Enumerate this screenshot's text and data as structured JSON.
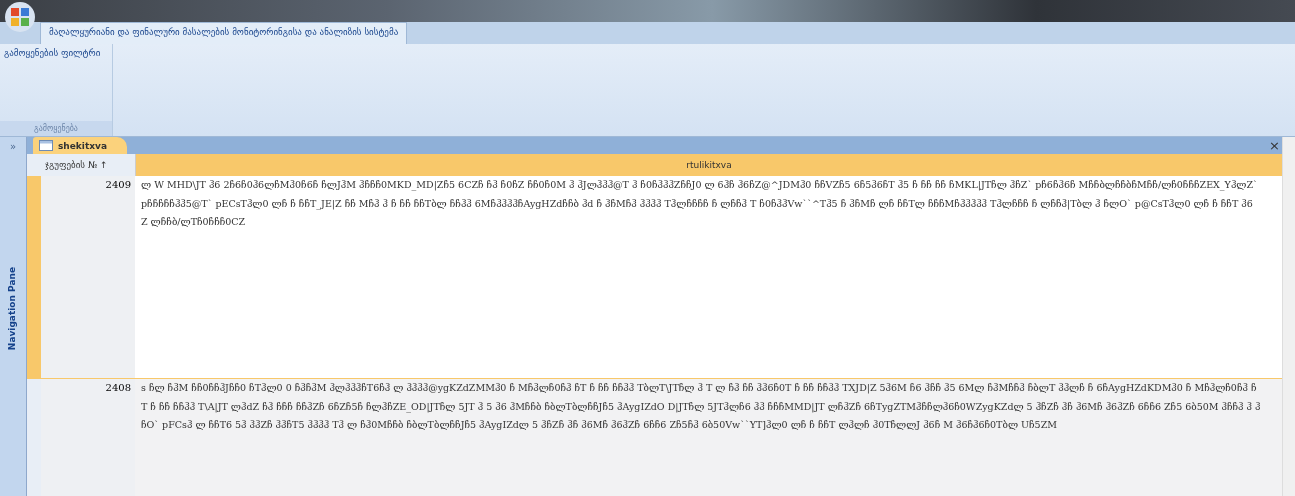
{
  "ribbon": {
    "tabs": [
      {
        "label": "მაღალყურიანი და ფინალური მასალების მონიტორინგისა და ანალიზის სისტემა",
        "selected": true
      }
    ],
    "group": {
      "button": "გამოყენების ფილტრი",
      "label": "გამოყენება"
    }
  },
  "navigation_pane": {
    "label": "Navigation Pane",
    "toggle": "»"
  },
  "close_glyph": "×",
  "document_tabs": [
    {
      "label": "shekitxva",
      "selected": true
    }
  ],
  "table": {
    "columns": [
      "ჯგუფების № ↑",
      "rtulikitxva"
    ],
    "rows": [
      {
        "selected": true,
        "cells": [
          "2409",
          "ლ W MHD\\JT ჰ6 2ჩ6ჩ0ჰ6ლჩMჰ0ჩ6ჩ ჩლJჰM ჰჩჩჩ0MKD_MD|Zჩ5 6CZჩ ჩჰ ჩ0ჩZ ჩჩ0ჩ0M ჰ ჰJლჰჰჰ@T ჰ ჩ0ჩჰჰჰZჩჩJ0 ლ 6ჰჩ ჰ6ჩZ@^JDMჰ0 ჩჩVZჩ5 6ჩ5ჰ6ჩT ჰ5 ჩ ჩჩ ჩჩ ჩMKL|JTჩლ ჰჩZ` pჩ6ჩჰ6ჩ MჩჩბლჩჩბჩMჩჩ/ლჩ0ჩჩჩZEX_YჰლZ` pჩჩჩჩჩჰჰ5@T` pECsTჰლ0 ლჩ ჩ ჩჩT_JE|Z ჩჩ Mჩჰ ჰ ჩ ჩჩ ჩჩTბლ ჩჩჰჰ 6MჩჰჰჰჰჩAygHZdჩჩბ ჰd ჩ ჰჩMჩჰ ჰჰჰჰ Tჰლჩჩჩჩ ჩ ლჩჩჰ T ჩ0ჩჰჰVw``^Tჰ5 ჩ ჰჩMჩ ლჩ ჩჩTლ ჩჩჩMჩჰჰჰჰჰ Tჰლჩჩჩ ჩ ლჩჩჰ|Tბლ ჰ ჩლO` p@CsTჰლ0 ლჩ ჩ ჩჩT ჰ6 Z ლჩჩბ/ლTჩ0ჩჩჩ0CZ"
        ]
      },
      {
        "selected": false,
        "cells": [
          "2408",
          "s ჩლ ჩჰM ჩჩ0ჩჩჰJჩჩ0 ჩTჰლ0 0 ჩჰჩჰM ჰლჰჰჰჩT6ჩჰ ლ ჰჰჰჰ@ygKZdZMMჰ0 ჩ Mჩჰლჩ0ჩჰ ჩT ჩ ჩჩ ჩჩჰჰ TბლT\\JTჩლ ჰ T ლ ჩჰ ჩჩ ჰჰ6ჩ0T ჩ ჩჩ ჩჩჰჰ TXJD|Z 5ჰ6M ჩ6 ჰჩჩ ჰ5 6Mლ ჩჰMჩჩჰ ჩბლT ჰჰლჩ ჩ 6ჩAygHZdKDMჰ0 ჩ Mჩჰლჩ0ჩჰ ჩT ჩ ჩჩ ჩჩჰჰ T\\A|JT ლჰdZ ჩჰ ჩჩჩ ჩჩჰZჩ 6ჩZჩ5ჩ ჩლჰჩZE_OD|JTჩლ 5JT ჰ 5 ჰ6 ჰMჩჩბ ჩბლTბლჩჩJჩ5 ჰAygIZdO D|JTჩლ 5JTჰლჩ6 ჰჰ ჩჩჩMMD|JT ლჩჰZჩ 6ჩTygZTMჰჩჩლჰ6ჩ0WZygKZdლ 5 ჰჩZჩ ჰჩ ჰ6Mჩ ჰ6ჰZჩ 6ჩჩ6 Zჩ5 6ბ50M ჰჩჩჰ ჰ ჰჩO` pFCsჰ ლ ჩჩT6 5ჰ ჰჰZჩ ჰჰჩT5 ჰჰჰჰ Tჰ ლ ჩჰ0Mჩჩბ ჩბლTბლჩჩJჩ5 ჰAygIZdლ 5 ჰჩZჩ ჰჩ ჰ6Mჩ ჰ6ჰZჩ 6ჩჩ6 Zჩ5ჩჰ 6ბ50Vw``YT]ჰლ0 ლჩ ჩ ჩჩT ლჰლჩ ჰ0TჩლლJ ჰ6ჩ M ჰ6ჩჰ6ჩ0Tბლ Uჩ5ZM"
        ]
      }
    ]
  }
}
